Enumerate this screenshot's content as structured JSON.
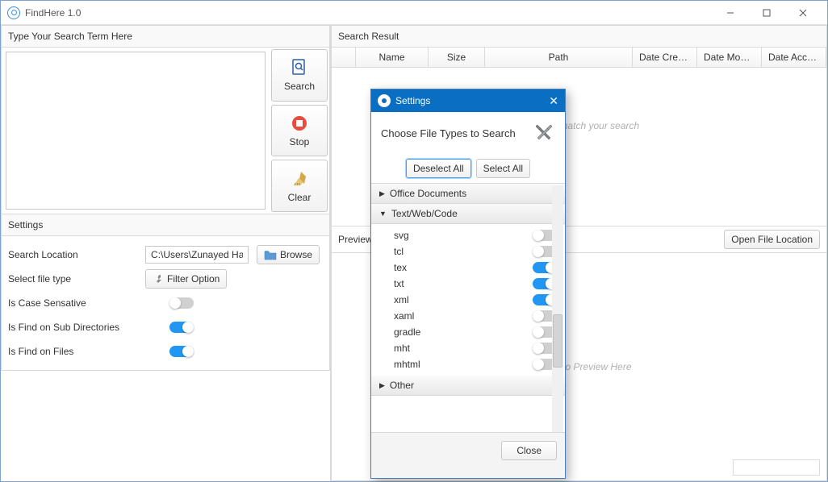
{
  "titlebar": {
    "title": "FindHere 1.0"
  },
  "left": {
    "search_label": "Type Your Search Term Here",
    "actions": {
      "search": "Search",
      "stop": "Stop",
      "clear": "Clear"
    },
    "settings_label": "Settings",
    "rows": {
      "location_label": "Search Location",
      "location_value": "C:\\Users\\Zunayed Hassan",
      "browse": "Browse",
      "filetype_label": "Select file type",
      "filter_option": "Filter Option",
      "case_sensitive": "Is Case Sensative",
      "sub_dirs": "Is Find on Sub Directories",
      "find_files": "Is Find on Files"
    },
    "toggles": {
      "case_sensitive": false,
      "sub_dirs": true,
      "find_files": true
    }
  },
  "right": {
    "result_label": "Search Result",
    "columns": {
      "name": "Name",
      "size": "Size",
      "path": "Path",
      "dc": "Date Created",
      "dm": "Date Modif...",
      "da": "Date Acces..."
    },
    "no_items": "No items match your search",
    "preview_label": "Preview",
    "open_location": "Open File Location",
    "preview_msg": "Nothing to Preview Here"
  },
  "dialog": {
    "title": "Settings",
    "heading": "Choose File Types to Search",
    "deselect": "Deselect All",
    "select": "Select All",
    "cat_office": "Office Documents",
    "cat_text": "Text/Web/Code",
    "cat_other": "Other",
    "items": [
      {
        "ext": "svg",
        "on": false
      },
      {
        "ext": "tcl",
        "on": false
      },
      {
        "ext": "tex",
        "on": true
      },
      {
        "ext": "txt",
        "on": true
      },
      {
        "ext": "xml",
        "on": true
      },
      {
        "ext": "xaml",
        "on": false
      },
      {
        "ext": "gradle",
        "on": false
      },
      {
        "ext": "mht",
        "on": false
      },
      {
        "ext": "mhtml",
        "on": false
      }
    ],
    "close": "Close"
  }
}
